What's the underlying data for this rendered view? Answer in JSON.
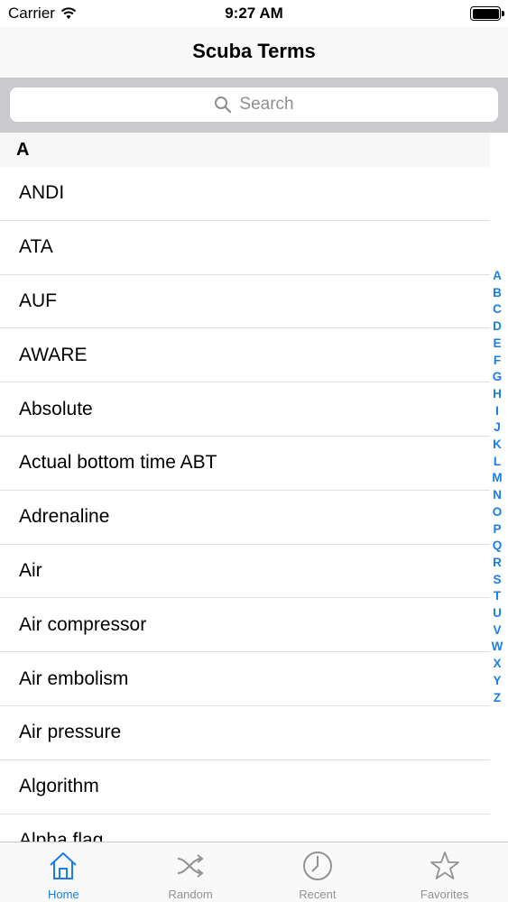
{
  "status": {
    "carrier": "Carrier",
    "time": "9:27 AM"
  },
  "nav": {
    "title": "Scuba Terms"
  },
  "search": {
    "placeholder": "Search"
  },
  "section": {
    "letter": "A"
  },
  "terms": [
    "ANDI",
    "ATA",
    "AUF",
    "AWARE",
    "Absolute",
    "Actual bottom time ABT",
    "Adrenaline",
    "Air",
    "Air compressor",
    "Air embolism",
    "Air pressure",
    "Algorithm",
    "Alpha flag"
  ],
  "index": [
    "A",
    "B",
    "C",
    "D",
    "E",
    "F",
    "G",
    "H",
    "I",
    "J",
    "K",
    "L",
    "M",
    "N",
    "O",
    "P",
    "Q",
    "R",
    "S",
    "T",
    "U",
    "V",
    "W",
    "X",
    "Y",
    "Z"
  ],
  "tabs": [
    {
      "label": "Home",
      "icon": "home-icon",
      "active": true
    },
    {
      "label": "Random",
      "icon": "shuffle-icon",
      "active": false
    },
    {
      "label": "Recent",
      "icon": "clock-icon",
      "active": false
    },
    {
      "label": "Favorites",
      "icon": "star-icon",
      "active": false
    }
  ],
  "colors": {
    "accent": "#1a7ee6",
    "inactive": "#929292"
  }
}
